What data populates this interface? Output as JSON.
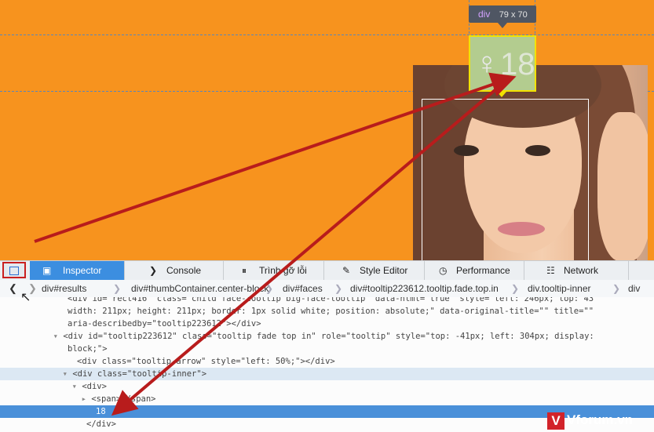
{
  "overlay": {
    "infobar_tag": "div",
    "infobar_dims": "79 x 70",
    "tooltip_age": "18",
    "tooltip_glyph": "person-icon"
  },
  "toolbar": {
    "tabs": [
      {
        "label": "Inspector",
        "icon": "inspector-icon",
        "active": true
      },
      {
        "label": "Console",
        "icon": "console-chevron-icon"
      },
      {
        "label": "Trình gỡ lỗi",
        "icon": "debugger-pause-icon"
      },
      {
        "label": "Style Editor",
        "icon": "style-editor-icon"
      },
      {
        "label": "Performance",
        "icon": "performance-gauge-icon"
      },
      {
        "label": "Network",
        "icon": "network-icon"
      }
    ]
  },
  "breadcrumbs": [
    "div#results",
    "div#thumbContainer.center-block",
    "div#faces",
    "div#tooltip223612.tooltip.fade.top.in",
    "div.tooltip-inner",
    "div"
  ],
  "markup": {
    "line0": "<div id=\"rect416\" class=\"child face-tooltip big-face-tooltip\" data-html=\"true\" style=\"left: 246px; top: 43",
    "line1": "width: 211px; height: 211px; border: 1px solid white; position: absolute;\" data-original-title=\"\" title=\"\"",
    "line2": "aria-describedby=\"tooltip223612\"></div>",
    "line3": "<div id=\"tooltip223612\" class=\"tooltip fade top in\" role=\"tooltip\" style=\"top: -41px; left: 304px; display:",
    "line4": "block;\">",
    "line5": "<div class=\"tooltip-arrow\" style=\"left: 50%;\"></div>",
    "line6": "<div class=\"tooltip-inner\">",
    "line7": "<div>",
    "line8": "<span></span>",
    "line9": "18",
    "line10": "</div>"
  },
  "watermark": {
    "badge": "V",
    "text": "Vforum.vn"
  },
  "colors": {
    "page_bg": "#f7931e",
    "active_tab": "#3c8ee0",
    "selected_row": "#4a90d9",
    "annotation_arrow": "#b81c1c"
  }
}
